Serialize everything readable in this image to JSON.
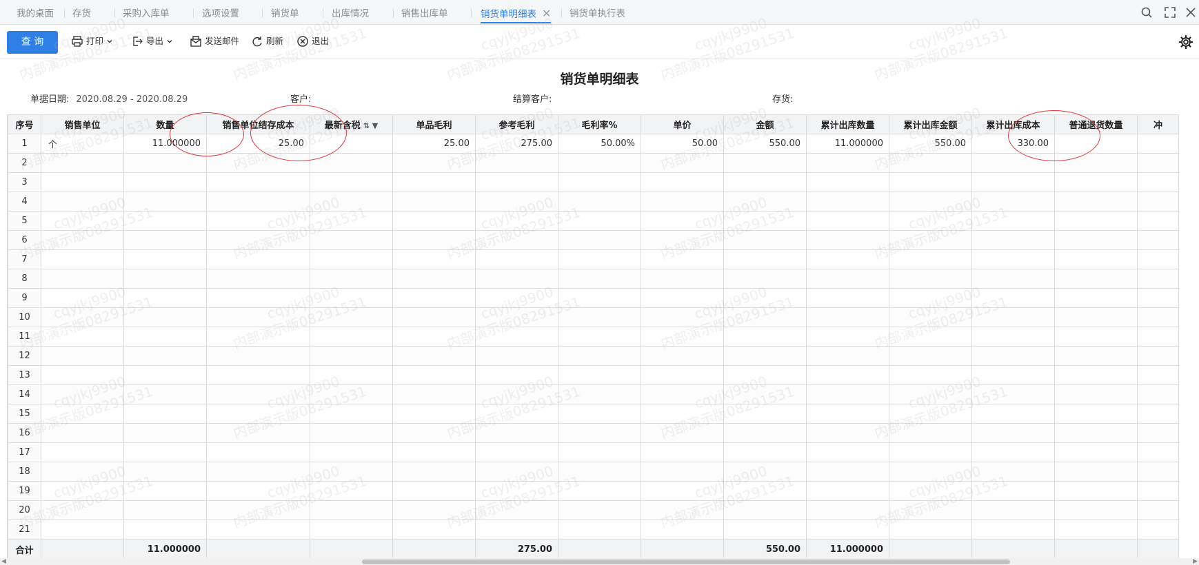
{
  "tabs": [
    {
      "label": "我的桌面"
    },
    {
      "label": "存货"
    },
    {
      "label": "采购入库单"
    },
    {
      "label": "选项设置"
    },
    {
      "label": "销货单"
    },
    {
      "label": "出库情况"
    },
    {
      "label": "销售出库单"
    },
    {
      "label": "销货单明细表",
      "active": true
    },
    {
      "label": "销货单执行表"
    }
  ],
  "toolbar": {
    "query_label": "查 询",
    "print_label": "打印",
    "export_label": "导出",
    "email_label": "发送邮件",
    "refresh_label": "刷新",
    "exit_label": "退出"
  },
  "report": {
    "title": "销货单明细表",
    "filters": {
      "date_label": "单据日期:",
      "date_value": "2020.08.29 - 2020.08.29",
      "customer_label": "客户:",
      "settle_customer_label": "结算客户:",
      "inventory_label": "存货:"
    }
  },
  "grid": {
    "columns": [
      "序号",
      "销售单位",
      "数量",
      "销售单位结存成本",
      "最新含税",
      "单品毛利",
      "参考毛利",
      "毛利率%",
      "单价",
      "金额",
      "累计出库数量",
      "累计出库金额",
      "累计出库成本",
      "普通退货数量",
      "冲"
    ],
    "row1": {
      "seq": "1",
      "unit": "个",
      "qty": "11.000000",
      "unit_cost": "25.00",
      "latest_price": "",
      "item_profit": "25.00",
      "ref_profit": "275.00",
      "margin": "50.00%",
      "price": "50.00",
      "amount": "550.00",
      "cum_out_qty": "11.000000",
      "cum_out_amount": "550.00",
      "cum_out_cost": "330.00",
      "return_qty": "",
      "extra": ""
    },
    "row_numbers": [
      "2",
      "3",
      "4",
      "5",
      "6",
      "7",
      "8",
      "9",
      "10",
      "11",
      "12",
      "13",
      "14",
      "15",
      "16",
      "17",
      "18",
      "19",
      "20",
      "21"
    ],
    "total": {
      "label": "合计",
      "qty": "11.000000",
      "ref_profit": "275.00",
      "amount": "550.00",
      "cum_out_qty": "11.000000"
    }
  },
  "watermark": {
    "line1": "cqyjkj9900",
    "line2": "内部演示版08291531"
  },
  "colors": {
    "accent": "#2f7fe6",
    "annotation": "#e0353b"
  }
}
